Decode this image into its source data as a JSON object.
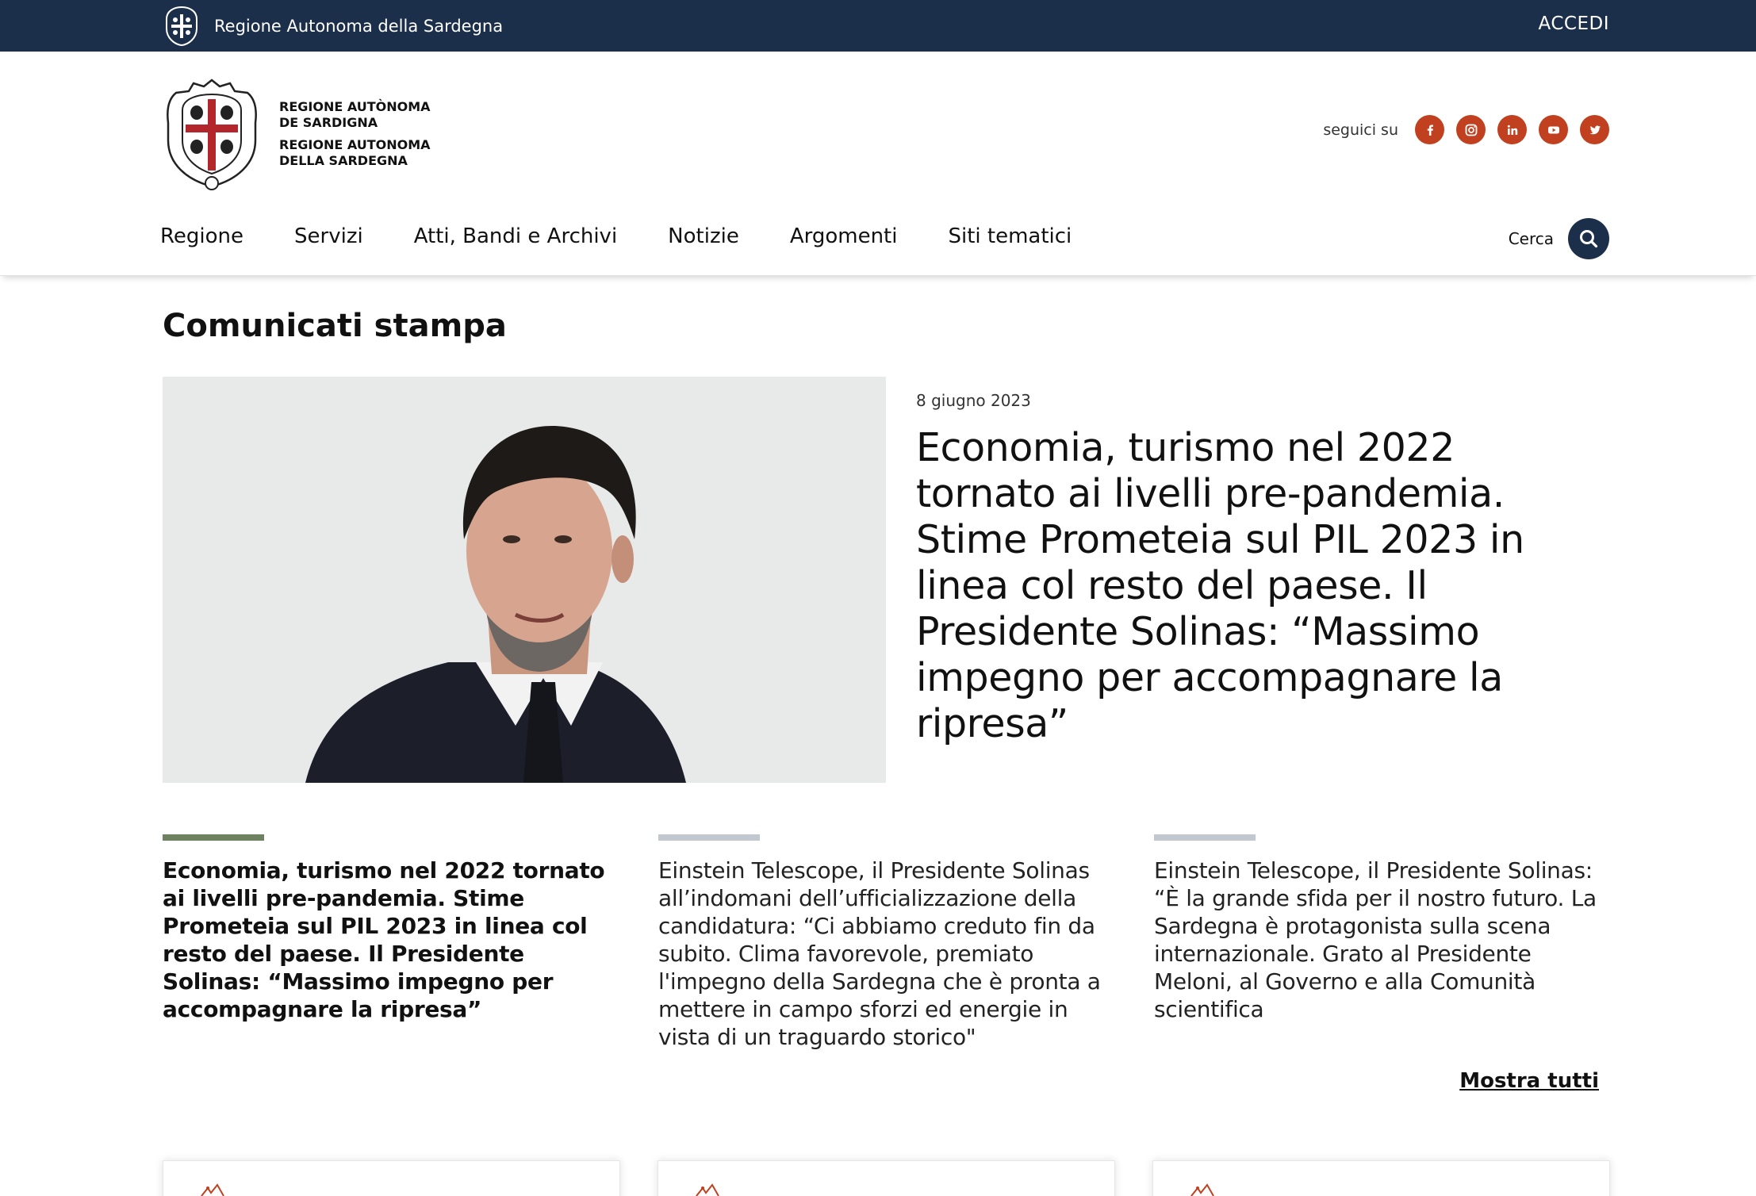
{
  "topbar": {
    "brand_text": "Regione Autonoma della Sardegna",
    "login_label": "ACCEDI"
  },
  "header": {
    "logo_line1": "REGIONE AUTÒNOMA",
    "logo_line2": "DE SARDIGNA",
    "logo_line3": "REGIONE AUTONOMA",
    "logo_line4": "DELLA SARDEGNA",
    "follow_label": "seguici su",
    "social": [
      "facebook-icon",
      "instagram-icon",
      "linkedin-icon",
      "youtube-icon",
      "twitter-icon"
    ],
    "search_label": "Cerca"
  },
  "nav": {
    "items": [
      {
        "label": "Regione"
      },
      {
        "label": "Servizi"
      },
      {
        "label": "Atti, Bandi e Archivi"
      },
      {
        "label": "Notizie"
      },
      {
        "label": "Argomenti"
      },
      {
        "label": "Siti tematici"
      }
    ]
  },
  "main": {
    "section_title": "Comunicati stampa",
    "hero": {
      "date": "8 giugno 2023",
      "title": "Economia, turismo nel 2022 tornato ai livelli pre-pandemia. Stime Prometeia sul PIL 2023 in linea col resto del paese. Il Presidente Solinas: “Massimo impegno per accompagnare la ripresa”"
    },
    "cards": [
      {
        "text": "Economia, turismo nel 2022 tornato ai livelli pre-pandemia. Stime Prometeia sul PIL 2023 in linea col resto del paese. Il Presidente Solinas: “Massimo impegno per accompagnare la ripresa”"
      },
      {
        "text": "Einstein Telescope, il Presidente Solinas all’indomani dell’ufficializzazione della candidatura: “Ci abbiamo creduto fin da subito. Clima favorevole, premiato l'impegno della Sardegna che è pronta a mettere in campo sforzi ed energie in vista di un traguardo storico\""
      },
      {
        "text": "Einstein Telescope, il Presidente Solinas: “È la grande sfida per il nostro futuro. La Sardegna è protagonista sulla scena internazionale. Grato al Presidente Meloni, al Governo e alla Comunità scientifica"
      }
    ],
    "show_all": "Mostra tutti"
  },
  "colors": {
    "topbar_bg": "#1c2f4a",
    "social_bg": "#c0401f",
    "active_bar": "#6e8262",
    "inactive_bar": "#c3c7cf"
  }
}
